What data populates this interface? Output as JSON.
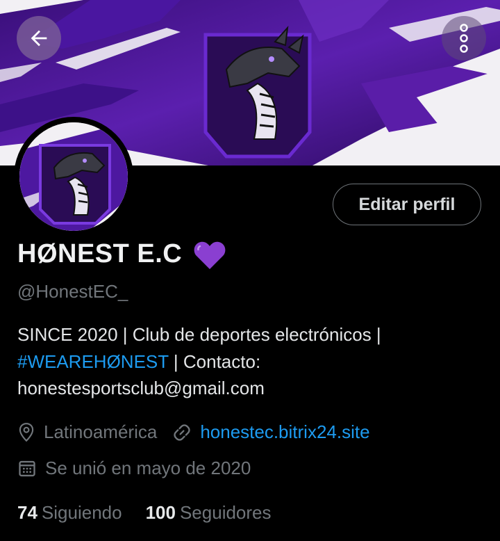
{
  "banner": {
    "colors": {
      "purple_dark": "#2e0c63",
      "purple_mid": "#5a1da8",
      "purple_light": "#8c4fe0",
      "paper": "#f2f0f4"
    },
    "logo_icon": "dragon-crest-icon"
  },
  "nav": {
    "back_icon": "arrow-left-icon",
    "more_icon": "vertical-dots-icon"
  },
  "profile": {
    "edit_label": "Editar perfil",
    "name": "HØNEST E.C",
    "name_emoji_icon": "purple-heart-icon",
    "handle": "@HonestEC_",
    "bio_part1": "SINCE 2020 | Club de deportes electrónicos | ",
    "bio_hashtag": "#WEAREHØNEST",
    "bio_part2": " | Contacto: honestesportsclub@gmail.com",
    "location": "Latinoamérica",
    "website": "honestec.bitrix24.site",
    "joined": "Se unió en mayo de 2020",
    "following_count": "74",
    "following_label": "Siguiendo",
    "followers_count": "100",
    "followers_label": "Seguidores"
  },
  "colors": {
    "accent": "#1d9bf0",
    "heart": "#8a3fd1"
  }
}
